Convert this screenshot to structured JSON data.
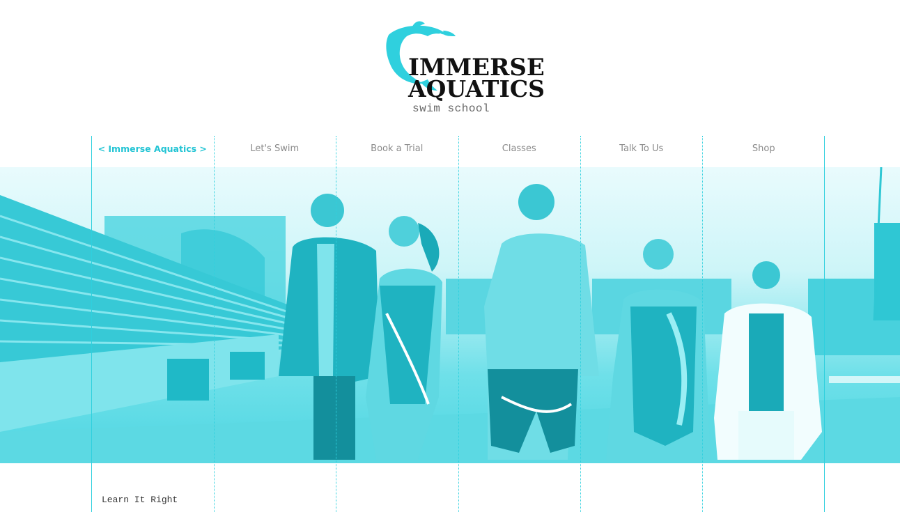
{
  "logo": {
    "line1": "IMMERSE",
    "line2": "AQUATICS",
    "tagline": "swim school"
  },
  "nav": {
    "items": [
      {
        "label": "< Immerse Aquatics >",
        "active": true
      },
      {
        "label": "Let's Swim",
        "active": false
      },
      {
        "label": "Book a Trial",
        "active": false
      },
      {
        "label": "Classes",
        "active": false
      },
      {
        "label": "Talk To Us",
        "active": false
      },
      {
        "label": "Shop",
        "active": false
      }
    ]
  },
  "content": {
    "intro": "Learn It Right"
  },
  "colors": {
    "accent": "#2fd0de",
    "active_nav": "#22c4d4",
    "nav_text": "#8a8a8a"
  },
  "icons": {
    "logo_mark": "dolphin-icon"
  }
}
